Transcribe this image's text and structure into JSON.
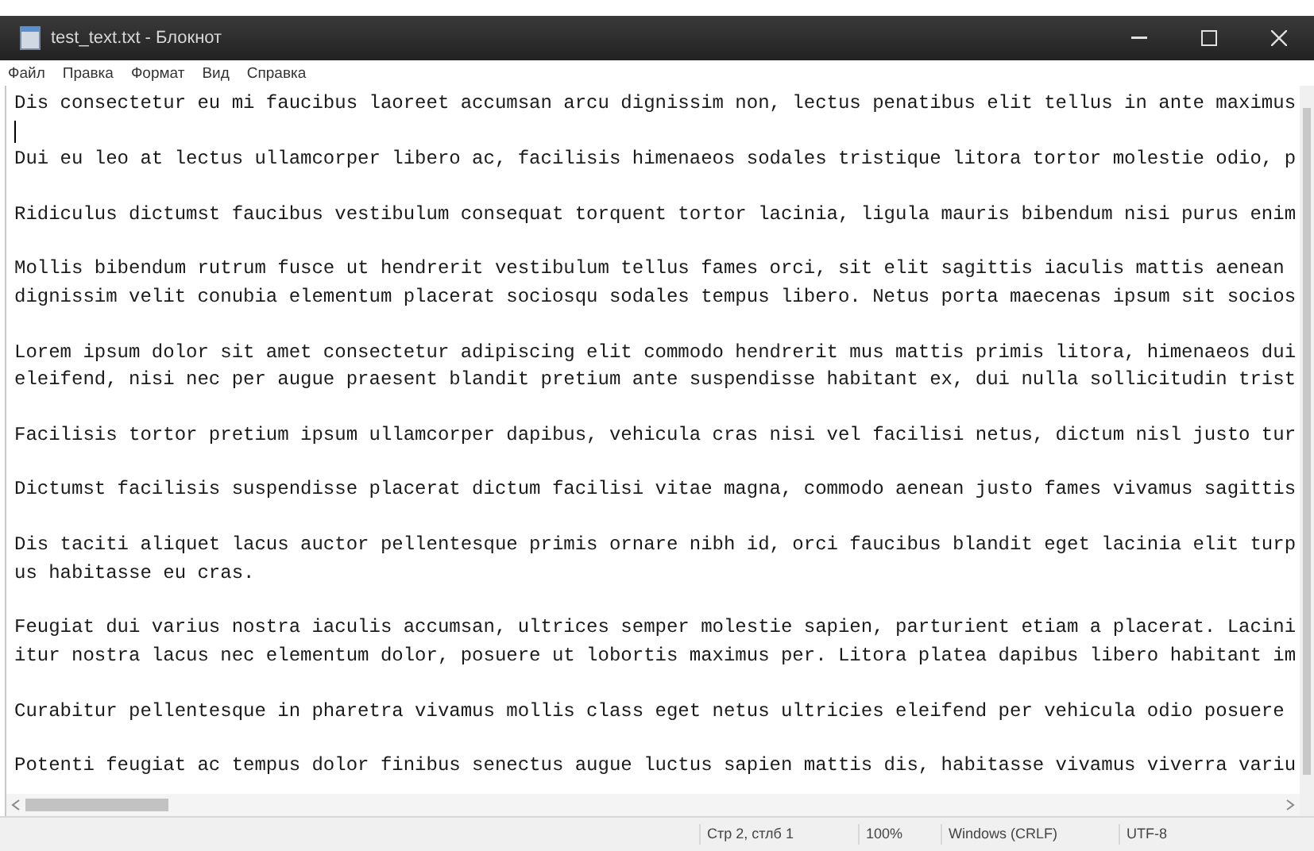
{
  "window": {
    "title": "test_text.txt - Блокнот"
  },
  "menu": [
    "Файл",
    "Правка",
    "Формат",
    "Вид",
    "Справка"
  ],
  "editor": {
    "lines": [
      {
        "kind": "text",
        "text": "Dis consectetur eu mi faucibus laoreet accumsan arcu dignissim non, lectus penatibus elit tellus in ante maximus"
      },
      {
        "kind": "blank",
        "caret": true
      },
      {
        "kind": "text",
        "text": "Dui eu leo at lectus ullamcorper libero ac, facilisis himenaeos sodales tristique litora tortor molestie odio, p"
      },
      {
        "kind": "blank",
        "caret": false
      },
      {
        "kind": "text",
        "text": "Ridiculus dictumst faucibus vestibulum consequat torquent tortor lacinia, ligula mauris bibendum nisi purus enim"
      },
      {
        "kind": "blank",
        "caret": false
      },
      {
        "kind": "text",
        "text": "Mollis bibendum rutrum fusce ut hendrerit vestibulum tellus fames orci, sit elit sagittis iaculis mattis aenean"
      },
      {
        "kind": "text",
        "text": "dignissim velit conubia elementum placerat sociosqu sodales tempus libero. Netus porta maecenas ipsum sit socios"
      },
      {
        "kind": "blank",
        "caret": false
      },
      {
        "kind": "text",
        "text": "Lorem ipsum dolor sit amet consectetur adipiscing elit commodo hendrerit mus mattis primis litora, himenaeos dui"
      },
      {
        "kind": "text",
        "text": "eleifend, nisi nec per augue praesent blandit pretium ante suspendisse habitant ex, dui nulla sollicitudin trist"
      },
      {
        "kind": "blank",
        "caret": false
      },
      {
        "kind": "text",
        "text": "Facilisis tortor pretium ipsum ullamcorper dapibus, vehicula cras nisi vel facilisi netus, dictum nisl justo tur"
      },
      {
        "kind": "blank",
        "caret": false
      },
      {
        "kind": "text",
        "text": "Dictumst facilisis suspendisse placerat dictum facilisi vitae magna, commodo aenean justo fames vivamus sagittis"
      },
      {
        "kind": "blank",
        "caret": false
      },
      {
        "kind": "text",
        "text": "Dis taciti aliquet lacus auctor pellentesque primis ornare nibh id, orci faucibus blandit eget lacinia elit turp"
      },
      {
        "kind": "text",
        "text": "us habitasse eu cras."
      },
      {
        "kind": "blank",
        "caret": false
      },
      {
        "kind": "text",
        "text": "Feugiat dui varius nostra iaculis accumsan, ultrices semper molestie sapien, parturient etiam a placerat. Lacini"
      },
      {
        "kind": "text",
        "text": "itur nostra lacus nec elementum dolor, posuere ut lobortis maximus per. Litora platea dapibus libero habitant im"
      },
      {
        "kind": "blank",
        "caret": false
      },
      {
        "kind": "text",
        "text": "Curabitur pellentesque in pharetra vivamus mollis class eget netus ultricies eleifend per vehicula odio posuere"
      },
      {
        "kind": "blank",
        "caret": false
      },
      {
        "kind": "text",
        "text": "Potenti feugiat ac tempus dolor finibus senectus augue luctus sapien mattis dis, habitasse vivamus viverra variu"
      }
    ]
  },
  "status_bar": [
    "Стр 2, стлб 1",
    "100%",
    "Windows (CRLF)",
    "UTF-8"
  ]
}
